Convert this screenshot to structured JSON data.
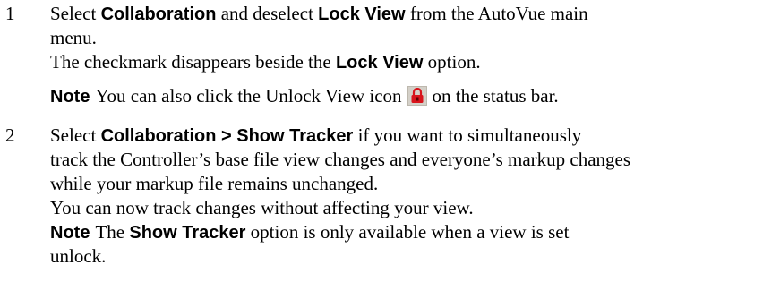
{
  "step1": {
    "number": "1",
    "line1_a": "Select ",
    "line1_b": "Collaboration",
    "line1_c": " and deselect ",
    "line1_d": "Lock View",
    "line1_e": " from the AutoVue main",
    "line2": "menu.",
    "line3_a": "The checkmark disappears beside the ",
    "line3_b": "Lock View",
    "line3_c": " option.",
    "note_label": "Note",
    "note_a": "You can also click the Unlock View icon",
    "note_b": "on the status bar.",
    "note_icon": "unlock-view-icon"
  },
  "step2": {
    "number": "2",
    "line1_a": "Select ",
    "line1_b": "Collaboration > Show Tracker",
    "line1_c": " if you want to simultaneously",
    "line2": "track the Controller’s base file view changes and everyone’s markup changes",
    "line3": "while your markup file remains unchanged.",
    "line4": "You can now track changes without affecting your view.",
    "note_label": "Note",
    "note_a": "The ",
    "note_b": "Show Tracker",
    "note_c": " option is only available when a view is set",
    "note_line2": "unlock."
  },
  "colors": {
    "lock_red": "#d8141c",
    "icon_bg": "#d4d0c8"
  }
}
